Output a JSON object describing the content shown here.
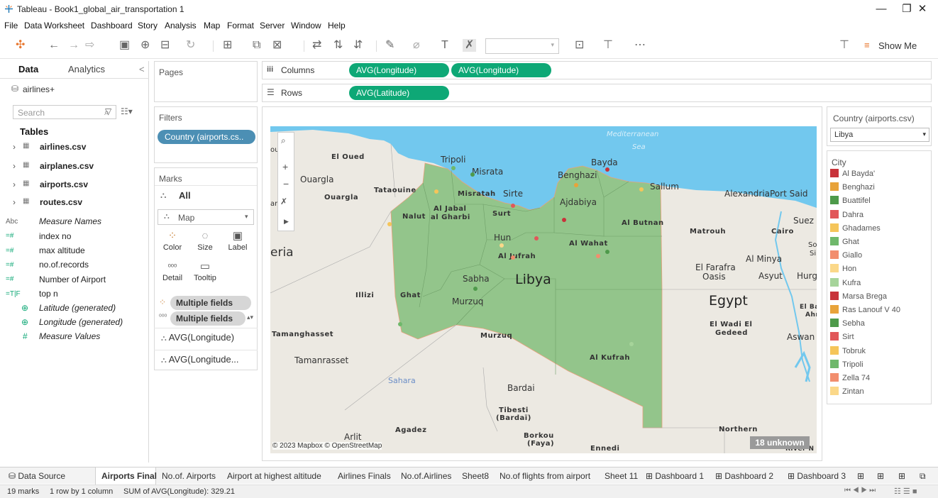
{
  "window": {
    "title": "Tableau - Book1_global_air_transportation 1",
    "minimize": "—",
    "restore": "❐",
    "close": "✕"
  },
  "menu": [
    "File",
    "Data",
    "Worksheet",
    "Dashboard",
    "Story",
    "Analysis",
    "Map",
    "Format",
    "Server",
    "Window",
    "Help"
  ],
  "toolbar": {
    "show_me": "Show Me"
  },
  "left_pane": {
    "tabs": [
      "Data",
      "Analytics"
    ],
    "collapse": "<",
    "datasource": "airlines+",
    "search_placeholder": "Search",
    "tables_heading": "Tables",
    "tables": [
      "airlines.csv",
      "airplanes.csv",
      "airports.csv",
      "routes.csv"
    ],
    "fields": [
      {
        "icon": "Abc",
        "name": "Measure Names",
        "italic": true
      },
      {
        "icon": "=#",
        "name": "index no",
        "italic": false
      },
      {
        "icon": "=#",
        "name": "max altitude",
        "italic": false
      },
      {
        "icon": "=#",
        "name": "no.of.records",
        "italic": false
      },
      {
        "icon": "=#",
        "name": "Number of Airport",
        "italic": false
      },
      {
        "icon": "=T|F",
        "name": "top n",
        "italic": false
      },
      {
        "icon": "⊕",
        "name": "Latitude (generated)",
        "italic": true
      },
      {
        "icon": "⊕",
        "name": "Longitude (generated)",
        "italic": true
      },
      {
        "icon": "#",
        "name": "Measure Values",
        "italic": true
      }
    ]
  },
  "pages": {
    "title": "Pages"
  },
  "filters": {
    "title": "Filters",
    "pill": "Country (airports.cs.."
  },
  "marks": {
    "title": "Marks",
    "all": "All",
    "type": "Map",
    "buttons": [
      "Color",
      "Size",
      "Label",
      "Detail",
      "Tooltip"
    ],
    "fields": [
      "Multiple fields",
      "Multiple fields"
    ],
    "layers": [
      "AVG(Longitude)",
      "AVG(Longitude..."
    ]
  },
  "shelves": {
    "columns_label": "Columns",
    "columns": [
      "AVG(Longitude)",
      "AVG(Longitude)"
    ],
    "rows_label": "Rows",
    "rows": [
      "AVG(Latitude)"
    ]
  },
  "map": {
    "labels": {
      "sea": "Mediterranean",
      "sea2": "Sea",
      "libya": "Libya",
      "egypt": "Egypt",
      "tripoli": "Tripoli",
      "misrata": "Misrata",
      "bayda": "Bayda",
      "benghazi": "Benghazi",
      "sallum": "Sallum",
      "alexandria": "Alexandria",
      "portsaid": "Port Said",
      "eloued": "El Oued",
      "ouargla1": "Ouargla",
      "ouargla2": "Ouargla",
      "tataouine": "Tataouine",
      "misratah": "Misratah",
      "sirte": "Sirte",
      "ajdabiya": "Ajdabiya",
      "suez": "Suez",
      "jabal": "Al Jabal",
      "gharbi": "al Gharbi",
      "nalut": "Nalut",
      "surt": "Surt",
      "butnan": "Al Butnan",
      "matrouh": "Matrouh",
      "cairo": "Cairo",
      "hun": "Hun",
      "wahat": "Al Wahat",
      "jufrah": "Al Jufrah",
      "minya": "Al Minya",
      "farafra": "El Farafra",
      "oasis": "Oasis",
      "asyut": "Asyut",
      "hurg": "Hurg",
      "sabha": "Sabha",
      "illizi": "Illizi",
      "ghat": "Ghat",
      "murzuq1": "Murzuq",
      "murzuq2": "Murzuq",
      "wadi": "El Wadi El",
      "gedeed": "Gedeed",
      "elbah": "El Bah",
      "ahm": "Ahm",
      "tamanghasset": "Tamanghasset",
      "tamanrasset": "Tamanrasset",
      "kufrah": "Al Kufrah",
      "aswan": "Aswan",
      "sahara": "Sahara",
      "bardai": "Bardai",
      "tibesti": "Tibesti",
      "bardai2": "(Bardaï)",
      "agadez": "Agadez",
      "arlit": "Arlit",
      "borkou": "Borkou",
      "faya": "(Faya)",
      "ennedi": "Ennedi",
      "northern": "Northern",
      "river": "River N",
      "eria": "eria",
      "ar": "ar",
      "ou": "ou",
      "so": "So",
      "si": "Si"
    },
    "attribution": "© 2023 Mapbox © OpenStreetMap",
    "unknown": "18 unknown"
  },
  "filter_card": {
    "title": "Country (airports.csv)",
    "selected": "Libya"
  },
  "legend": {
    "title": "City",
    "items": [
      {
        "name": "Al Bayda'",
        "color": "#c8333a"
      },
      {
        "name": "Benghazi",
        "color": "#e8a33a"
      },
      {
        "name": "Buattifel",
        "color": "#4e9a4a"
      },
      {
        "name": "Dahra",
        "color": "#e15759"
      },
      {
        "name": "Ghadames",
        "color": "#f5c55a"
      },
      {
        "name": "Ghat",
        "color": "#6fb86b"
      },
      {
        "name": "Giallo",
        "color": "#f28e6e"
      },
      {
        "name": "Hon",
        "color": "#fbd889"
      },
      {
        "name": "Kufra",
        "color": "#a6d49a"
      },
      {
        "name": "Marsa Brega",
        "color": "#c8333a"
      },
      {
        "name": "Ras Lanouf V 40",
        "color": "#e8a33a"
      },
      {
        "name": "Sebha",
        "color": "#4e9a4a"
      },
      {
        "name": "Sirt",
        "color": "#e15759"
      },
      {
        "name": "Tobruk",
        "color": "#f5c55a"
      },
      {
        "name": "Tripoli",
        "color": "#6fb86b"
      },
      {
        "name": "Zella 74",
        "color": "#f28e6e"
      },
      {
        "name": "Zintan",
        "color": "#fbd889"
      }
    ]
  },
  "sheet_tabs": [
    "Data Source",
    "Airports Final",
    "No.of. Airports",
    "Airport at highest altitude",
    "Airlines Finals",
    "No.of.Airlines",
    "Sheet8",
    "No.of flights from airport",
    "Sheet 11",
    "Dashboard 1",
    "Dashboard 2",
    "Dashboard 3"
  ],
  "status": {
    "marks": "19 marks",
    "rows": "1 row by 1 column",
    "sum": "SUM of AVG(Longitude): 329.21"
  },
  "colors": {
    "pill": "#0ea876",
    "filter_pill": "#4c8fb4",
    "sea": "#72c8ee",
    "libya": "#93c58b",
    "land": "#ece9e2"
  }
}
